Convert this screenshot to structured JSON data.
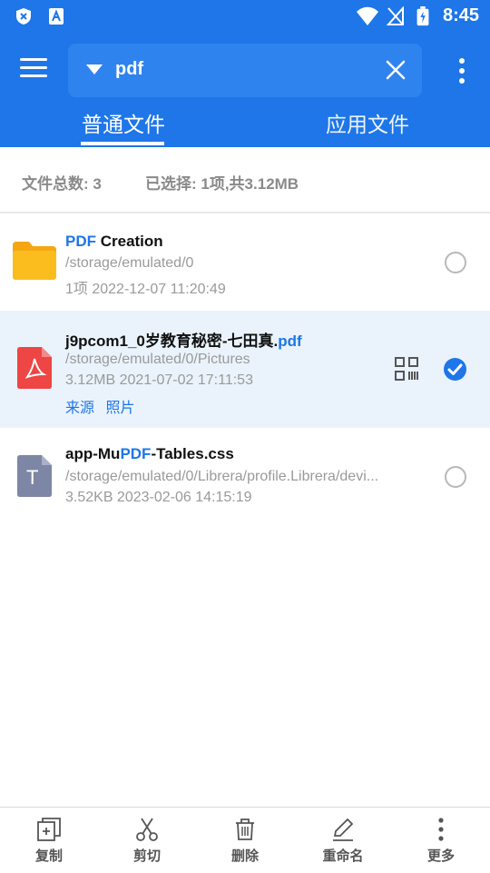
{
  "status_bar": {
    "time": "8:45"
  },
  "header": {
    "search_text": "pdf",
    "tabs": [
      {
        "label": "普通文件",
        "active": true
      },
      {
        "label": "应用文件",
        "active": false
      }
    ]
  },
  "summary": {
    "count": "文件总数: 3",
    "selected": "已选择: 1项,共3.12MB"
  },
  "files": [
    {
      "type": "folder",
      "title_hl": "PDF",
      "title_rest": " Creation",
      "path": "/storage/emulated/0",
      "meta": "1项  2022-12-07 11:20:49",
      "selected": false
    },
    {
      "type": "pdf",
      "title_pre": "j9pcom1_0岁教育秘密-七田真.",
      "title_hl": "pdf",
      "path": "/storage/emulated/0/Pictures",
      "meta": "3.12MB  2021-07-02 17:11:53",
      "links": [
        "来源",
        "照片"
      ],
      "selected": true
    },
    {
      "type": "text",
      "title_pre": "app-Mu",
      "title_hl": "PDF",
      "title_post": "-Tables.css",
      "path": "/storage/emulated/0/Librera/profile.Librera/devi...",
      "meta": "3.52KB  2023-02-06 14:15:19",
      "icon_letter": "T",
      "selected": false
    }
  ],
  "bottom_bar": [
    {
      "label": "复制",
      "icon": "copy-icon"
    },
    {
      "label": "剪切",
      "icon": "scissors-icon"
    },
    {
      "label": "删除",
      "icon": "trash-icon"
    },
    {
      "label": "重命名",
      "icon": "pencil-icon"
    },
    {
      "label": "更多",
      "icon": "more-vertical-icon"
    }
  ],
  "colors": {
    "accent": "#1e76e8",
    "folder": "#fbbd1e",
    "pdf": "#ee4545",
    "text_file": "#7e86a6"
  }
}
